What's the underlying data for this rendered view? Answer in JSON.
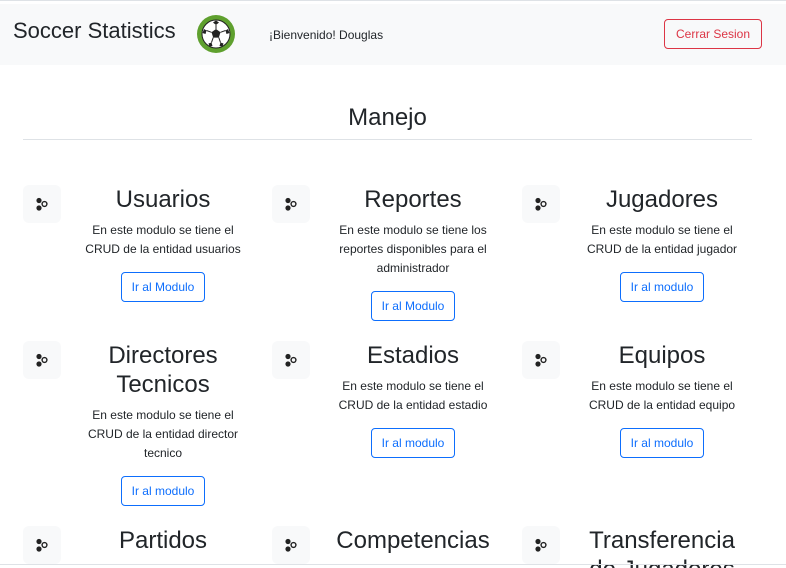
{
  "navbar": {
    "brand": "Soccer Statistics",
    "logo_icon": "soccer-ball-icon",
    "welcome": "¡Bienvenido! Douglas",
    "logout_label": "Cerrar Sesion"
  },
  "section": {
    "title": "Manejo"
  },
  "module_icon": "toggle-icon",
  "modules": [
    {
      "title": "Usuarios",
      "description": "En este modulo se tiene el CRUD de la entidad usuarios",
      "button": "Ir al Modulo"
    },
    {
      "title": "Reportes",
      "description": "En este modulo se tiene los reportes disponibles para el administrador",
      "button": "Ir al Modulo"
    },
    {
      "title": "Jugadores",
      "description": "En este modulo se tiene el CRUD de la entidad jugador",
      "button": "Ir al modulo"
    },
    {
      "title": "Directores Tecnicos",
      "description": "En este modulo se tiene el CRUD de la entidad director tecnico",
      "button": "Ir al modulo"
    },
    {
      "title": "Estadios",
      "description": "En este modulo se tiene el CRUD de la entidad estadio",
      "button": "Ir al modulo"
    },
    {
      "title": "Equipos",
      "description": "En este modulo se tiene el CRUD de la entidad equipo",
      "button": "Ir al modulo"
    },
    {
      "title": "Partidos",
      "description": "",
      "button": ""
    },
    {
      "title": "Competencias",
      "description": "",
      "button": ""
    },
    {
      "title": "Transferencia de Jugadores",
      "description": "",
      "button": ""
    }
  ],
  "colors": {
    "navbar_bg": "#f8f9fa",
    "danger": "#dc3545",
    "primary": "#0d6efd",
    "ball_ring": "#5fa02e"
  }
}
